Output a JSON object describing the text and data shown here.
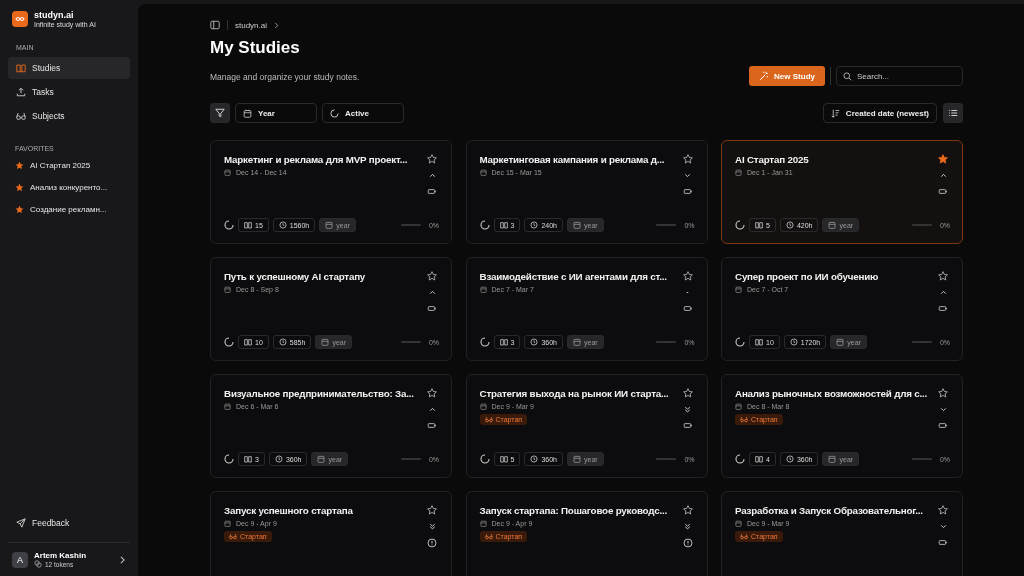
{
  "sidebar": {
    "app_name": "studyn.ai",
    "app_tagline": "Infinite study with AI",
    "sections": [
      {
        "title": "MAIN",
        "items": [
          {
            "label": "Studies",
            "selected": true
          },
          {
            "label": "Tasks",
            "selected": false
          },
          {
            "label": "Subjects",
            "selected": false
          }
        ]
      }
    ],
    "favorites_title": "FAVORITES",
    "favorites": [
      "AI Стартап 2025",
      "Анализ конкуренто...",
      "Создание рекламн..."
    ],
    "feedback": "Feedback",
    "user": {
      "name": "Artem Kashin",
      "initial": "A",
      "tokens": "12 tokens"
    }
  },
  "breadcrumb": "studyn.ai",
  "title": "My Studies",
  "description": "Manage and organize your study notes.",
  "new_study": "New Study",
  "search": {
    "placeholder": "Search..."
  },
  "filters": [
    "Year",
    "Active"
  ],
  "sort": "Created date (newest)",
  "cards": [
    {
      "title": "Маркетинг и реклама для MVP проект...",
      "dates": "Dec 14 - Dec 14",
      "favorite": false,
      "selected": false,
      "priority": {
        "kind": "high"
      },
      "status": {
        "kind": "battery"
      },
      "notes": "15",
      "hours": "1560h",
      "period": "year",
      "level": 0,
      "percent": "0%"
    },
    {
      "title": "Маркетинговая кампания и реклама д...",
      "dates": "Dec 15 - Mar 15",
      "favorite": false,
      "selected": false,
      "priority": {
        "kind": "low"
      },
      "status": {
        "kind": "battery"
      },
      "notes": "3",
      "hours": "240h",
      "period": "year",
      "level": 0,
      "percent": "0%"
    },
    {
      "title": "AI Стартап 2025",
      "dates": "Dec 1 - Jan 31",
      "favorite": true,
      "selected": true,
      "priority": {
        "kind": "high"
      },
      "status": {
        "kind": "battery"
      },
      "notes": "5",
      "hours": "420h",
      "period": "year",
      "level": 0,
      "percent": "0%"
    },
    {
      "title": "Путь к успешному AI стартапу",
      "dates": "Dec 8 - Sep 8",
      "favorite": false,
      "selected": false,
      "priority": {
        "kind": "high"
      },
      "status": {
        "kind": "battery"
      },
      "notes": "10",
      "hours": "585h",
      "period": "year",
      "level": 0,
      "percent": "0%"
    },
    {
      "title": "Взаимодействие с ИИ агентами для ст...",
      "dates": "Dec 7 - Mar 7",
      "favorite": false,
      "selected": false,
      "priority": {
        "kind": "none"
      },
      "status": {
        "kind": "battery"
      },
      "notes": "3",
      "hours": "360h",
      "period": "year",
      "level": 0,
      "percent": "0%"
    },
    {
      "title": "Супер проект по ИИ обучению",
      "dates": "Dec 7 - Oct 7",
      "favorite": false,
      "selected": false,
      "priority": {
        "kind": "high"
      },
      "status": {
        "kind": "battery"
      },
      "notes": "10",
      "hours": "1720h",
      "period": "year",
      "level": 0,
      "percent": "0%"
    },
    {
      "title": "Визуальное предпринимательство: За...",
      "dates": "Dec 6 - Mar 6",
      "favorite": false,
      "selected": false,
      "priority": {
        "kind": "high"
      },
      "status": {
        "kind": "battery"
      },
      "notes": "3",
      "hours": "360h",
      "period": "year",
      "level": 0,
      "percent": "0%"
    },
    {
      "title": "Стратегия выхода на рынок ИИ старта...",
      "dates": "Dec 9 - Mar 9",
      "tag": "Стартап",
      "favorite": false,
      "selected": false,
      "priority": {
        "kind": "lowest"
      },
      "status": {
        "kind": "battery"
      },
      "notes": "5",
      "hours": "360h",
      "period": "year",
      "level": 0,
      "percent": "0%"
    },
    {
      "title": "Анализ рыночных возможностей для с...",
      "dates": "Dec 8 - Mar 8",
      "tag": "Стартап",
      "favorite": false,
      "selected": false,
      "priority": {
        "kind": "low"
      },
      "status": {
        "kind": "battery"
      },
      "notes": "4",
      "hours": "360h",
      "period": "year",
      "level": 0,
      "percent": "0%"
    },
    {
      "title": "Запуск успешного стартапа",
      "dates": "Dec 9 - Apr 9",
      "tag": "Стартап",
      "favorite": false,
      "selected": false,
      "priority": {
        "kind": "lowest"
      },
      "status": {
        "kind": "alert"
      }
    },
    {
      "title": "Запуск стартапа: Пошаговое руководс...",
      "dates": "Dec 9 - Apr 9",
      "tag": "Стартап",
      "favorite": false,
      "selected": false,
      "priority": {
        "kind": "lowest"
      },
      "status": {
        "kind": "alert"
      }
    },
    {
      "title": "Разработка и Запуск Образовательног...",
      "dates": "Dec 9 - Mar 9",
      "tag": "Стартап",
      "favorite": false,
      "selected": false,
      "priority": {
        "kind": "low"
      },
      "status": {
        "kind": "battery"
      }
    }
  ]
}
